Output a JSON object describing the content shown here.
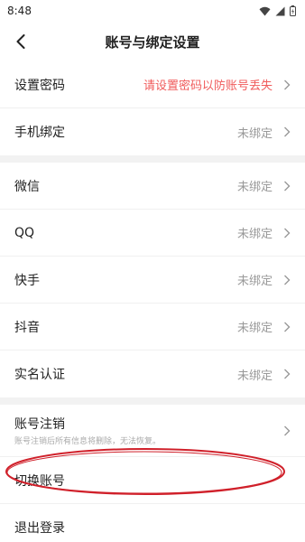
{
  "status_bar": {
    "time": "8:48"
  },
  "nav": {
    "title": "账号与绑定设置"
  },
  "rows_group1": [
    {
      "label": "设置密码",
      "value": "请设置密码以防账号丢失",
      "warn": true
    },
    {
      "label": "手机绑定",
      "value": "未绑定",
      "warn": false
    }
  ],
  "rows_group2": [
    {
      "label": "微信",
      "value": "未绑定"
    },
    {
      "label": "QQ",
      "value": "未绑定"
    },
    {
      "label": "快手",
      "value": "未绑定"
    },
    {
      "label": "抖音",
      "value": "未绑定"
    },
    {
      "label": "实名认证",
      "value": "未绑定"
    }
  ],
  "rows_group3": {
    "cancel": {
      "label": "账号注销",
      "sub": "账号注销后所有信息将删除，无法恢复。"
    },
    "switch": {
      "label": "切换账号"
    },
    "logout": {
      "label": "退出登录"
    }
  },
  "colors": {
    "warn": "#f05b5b",
    "highlight": "#d0202a",
    "separator": "#f2f2f2"
  }
}
